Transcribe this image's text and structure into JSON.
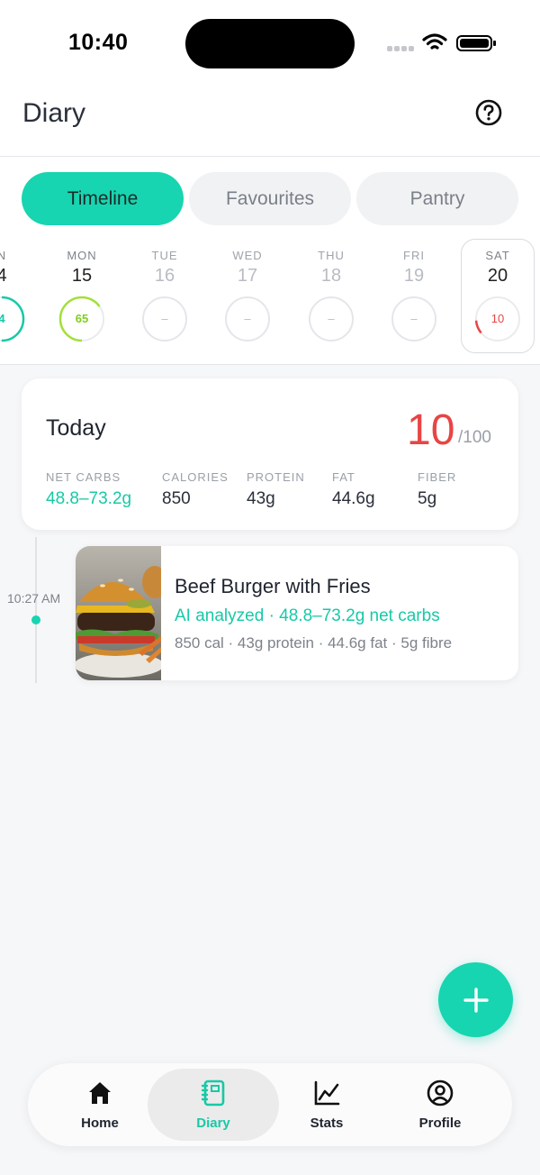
{
  "status_bar": {
    "time": "10:40"
  },
  "header": {
    "title": "Diary"
  },
  "tabs": [
    {
      "label": "Timeline",
      "active": true
    },
    {
      "label": "Favourites",
      "active": false
    },
    {
      "label": "Pantry",
      "active": false
    }
  ],
  "days": [
    {
      "name": "N",
      "num": "4",
      "score": "4",
      "ring_fraction": 0.5,
      "ring_color": "#17c9a6"
    },
    {
      "name": "MON",
      "num": "15",
      "score": "65",
      "ring_fraction": 0.65,
      "ring_color": "#a2e03a"
    },
    {
      "name": "TUE",
      "num": "16",
      "score": "–"
    },
    {
      "name": "WED",
      "num": "17",
      "score": "–"
    },
    {
      "name": "THU",
      "num": "18",
      "score": "–"
    },
    {
      "name": "FRI",
      "num": "19",
      "score": "–"
    },
    {
      "name": "SAT",
      "num": "20",
      "score": "10",
      "ring_fraction": 0.1,
      "ring_color": "#e84545",
      "selected": true
    }
  ],
  "today": {
    "title": "Today",
    "score": "10",
    "score_total": "/100",
    "macros": [
      {
        "label": "NET CARBS",
        "value": "48.8–73.2g",
        "accent": true
      },
      {
        "label": "CALORIES",
        "value": "850"
      },
      {
        "label": "PROTEIN",
        "value": "43g"
      },
      {
        "label": "FAT",
        "value": "44.6g"
      },
      {
        "label": "FIBER",
        "value": "5g"
      }
    ]
  },
  "timeline": [
    {
      "time": "10:27 AM",
      "name": "Beef Burger with Fries",
      "ai_line": "AI analyzed · 48.8–73.2g net carbs",
      "stats_line": "850 cal · 43g protein · 44.6g fat · 5g fibre"
    }
  ],
  "nav": [
    {
      "label": "Home",
      "icon": "home-icon"
    },
    {
      "label": "Diary",
      "icon": "diary-icon",
      "active": true
    },
    {
      "label": "Stats",
      "icon": "stats-icon"
    },
    {
      "label": "Profile",
      "icon": "profile-icon"
    }
  ],
  "colors": {
    "accent": "#17d5b0",
    "accent_text": "#17c9a6",
    "score_red": "#e84545"
  }
}
